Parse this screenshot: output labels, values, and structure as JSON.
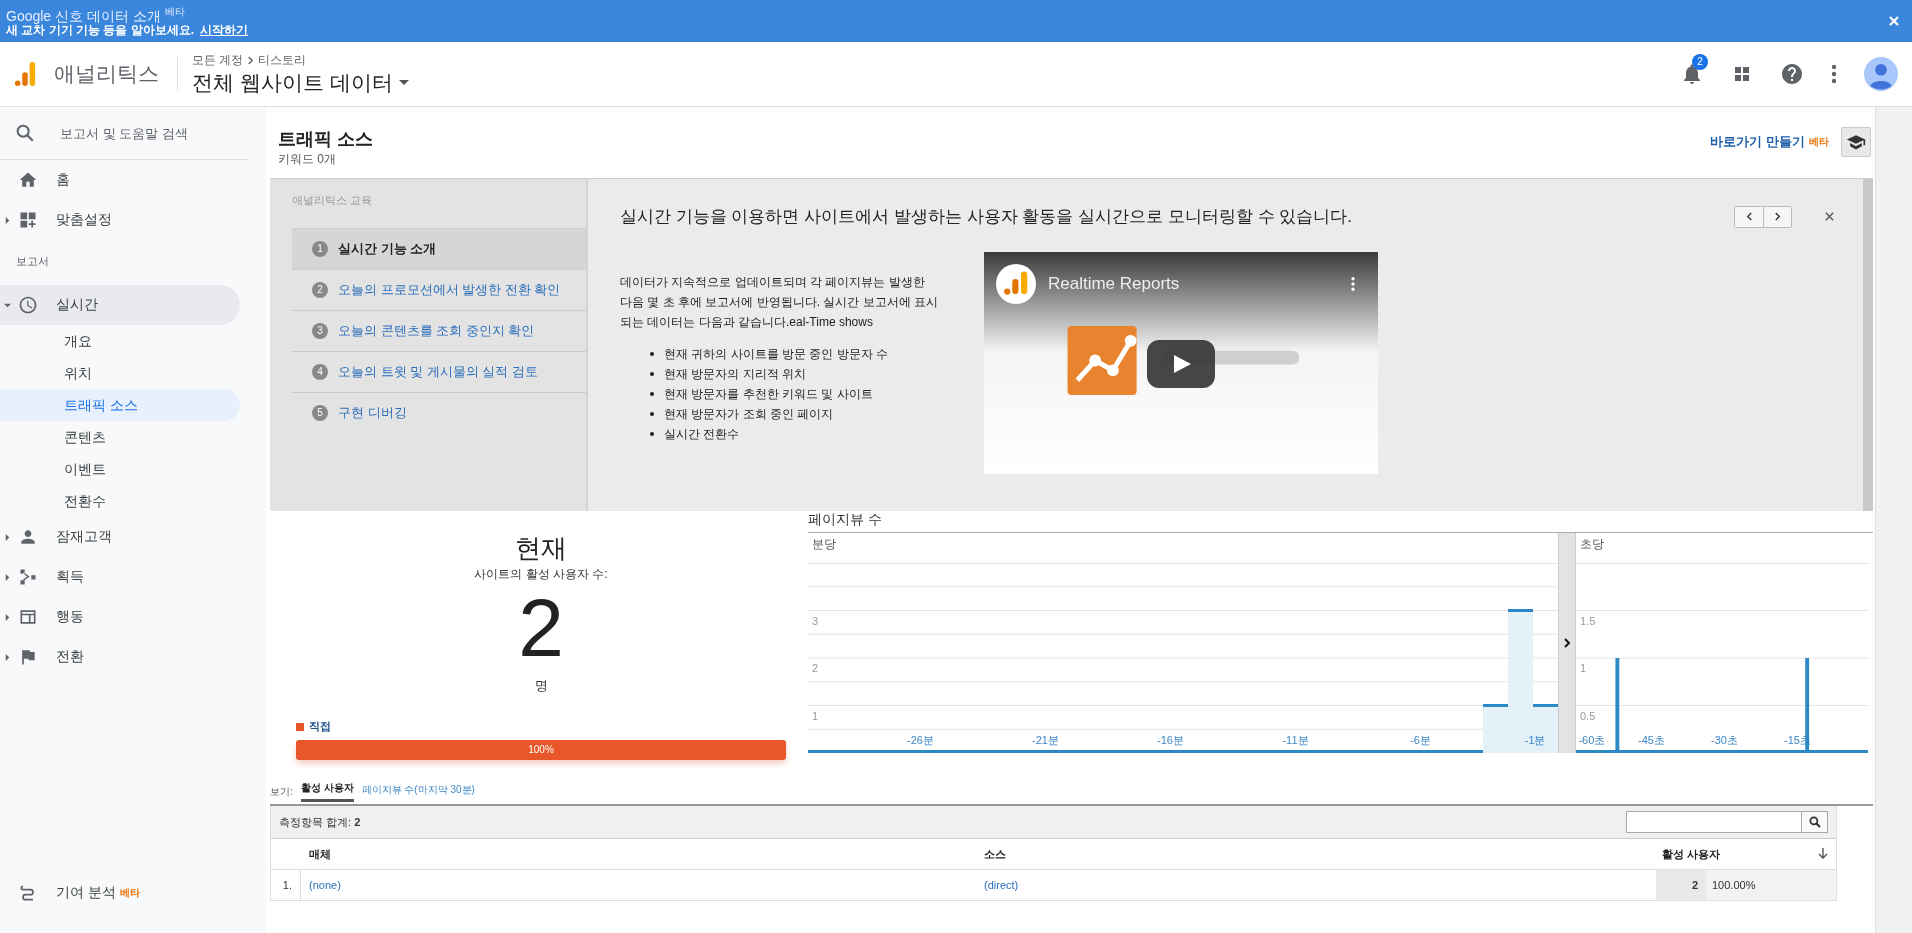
{
  "banner": {
    "title": "Google 신호 데이터 소개",
    "title_badge": "베타",
    "text": "새 교차 기기 기능 등을 알아보세요.",
    "link": "시작하기"
  },
  "header": {
    "app_name": "애널리틱스",
    "breadcrumb": [
      "모든 계정",
      "티스토리"
    ],
    "view": "전체 웹사이트 데이터",
    "notification_count": "2"
  },
  "sidebar": {
    "search": {
      "placeholder": "보고서 및 도움말 검색"
    },
    "top_items": [
      {
        "label": "홈",
        "kind": "link"
      },
      {
        "label": "맞춤설정",
        "kind": "group",
        "expanded": false
      }
    ],
    "section_label": "보고서",
    "report_items": [
      {
        "label": "실시간",
        "kind": "group",
        "expanded": true,
        "children": [
          {
            "label": "개요",
            "selected": false
          },
          {
            "label": "위치",
            "selected": false
          },
          {
            "label": "트래픽 소스",
            "selected": true
          },
          {
            "label": "콘텐츠",
            "selected": false
          },
          {
            "label": "이벤트",
            "selected": false
          },
          {
            "label": "전환수",
            "selected": false
          }
        ]
      },
      {
        "label": "잠재고객",
        "kind": "group",
        "expanded": false
      },
      {
        "label": "획득",
        "kind": "group",
        "expanded": false
      },
      {
        "label": "행동",
        "kind": "group",
        "expanded": false
      },
      {
        "label": "전환",
        "kind": "group",
        "expanded": false
      }
    ],
    "bottom_items": [
      {
        "label": "기여 분석",
        "badge": "베타"
      }
    ]
  },
  "page": {
    "title": "트래픽 소스",
    "subtitle": "키워드 0개",
    "shortcut": "바로가기 만들기",
    "shortcut_badge": "베타"
  },
  "education": {
    "heading": "애널리틱스 교육",
    "steps": [
      {
        "number": "1",
        "label": "실시간 기능 소개",
        "selected": true
      },
      {
        "number": "2",
        "label": "오늘의 프로모션에서 발생한 전환 확인",
        "selected": false
      },
      {
        "number": "3",
        "label": "오늘의 콘텐츠를 조회 중인지 확인",
        "selected": false
      },
      {
        "number": "4",
        "label": "오늘의 트윗 및 게시물의 실적 검토",
        "selected": false
      },
      {
        "number": "5",
        "label": "구현 디버깅",
        "selected": false
      }
    ],
    "title": "실시간 기능을 이용하면 사이트에서 발생하는 사용자 활동을 실시간으로 모니터링할 수 있습니다.",
    "description": "데이터가 지속적으로 업데이트되며 각 페이지뷰는 발생한 다음 몇 초 후에 보고서에 반영됩니다. 실시간 보고서에 표시되는 데이터는 다음과 같습니다.eal-Time shows",
    "bullets": [
      "현재 귀하의 사이트를 방문 중인 방문자 수",
      "현재 방문자의 지리적 위치",
      "현재 방문자를 추천한 키워드 및 사이트",
      "현재 방문자가 조회 중인 페이지",
      "실시간 전환수"
    ],
    "video": {
      "title": "Realtime Reports"
    }
  },
  "now": {
    "title": "현재",
    "label": "사이트의 활성 사용자 수:",
    "count": "2",
    "unit": "명",
    "legend": [
      {
        "label": "직접",
        "color": "#e8572a"
      }
    ],
    "bar": {
      "label": "100%",
      "level": 1
    }
  },
  "pageviews": {
    "title": "페이지뷰 수",
    "per_minute": {
      "label": "분당",
      "chart_data": {
        "type": "bar",
        "x": [
          -30,
          -29,
          -28,
          -27,
          -26,
          -25,
          -24,
          -23,
          -22,
          -21,
          -20,
          -19,
          -18,
          -17,
          -16,
          -15,
          -14,
          -13,
          -12,
          -11,
          -10,
          -9,
          -8,
          -7,
          -6,
          -5,
          -4,
          -3,
          -2,
          -1
        ],
        "values": [
          0,
          0,
          0,
          0,
          0,
          0,
          0,
          0,
          0,
          0,
          0,
          0,
          0,
          0,
          0,
          0,
          0,
          0,
          0,
          0,
          0,
          0,
          0,
          0,
          0,
          0,
          0,
          1,
          3,
          1
        ],
        "xlim": [
          -30.5,
          -0.5
        ],
        "ylim": [
          0,
          4
        ],
        "yticks": [
          1,
          2,
          3
        ],
        "grid": true,
        "xticks": [
          {
            "value": -26,
            "label": "-26분"
          },
          {
            "value": -21,
            "label": "-21분"
          },
          {
            "value": -16,
            "label": "-16분"
          },
          {
            "value": -11,
            "label": "-11분"
          },
          {
            "value": -6,
            "label": "-6분"
          },
          {
            "value": -1,
            "label": "-1분"
          }
        ]
      }
    },
    "per_second": {
      "label": "초당",
      "chart_data": {
        "type": "bar",
        "x": [
          -60,
          -59,
          -58,
          -57,
          -56,
          -55,
          -54,
          -53,
          -52,
          -51,
          -50,
          -49,
          -48,
          -47,
          -46,
          -45,
          -44,
          -43,
          -42,
          -41,
          -40,
          -39,
          -38,
          -37,
          -36,
          -35,
          -34,
          -33,
          -32,
          -31,
          -30,
          -29,
          -28,
          -27,
          -26,
          -25,
          -24,
          -23,
          -22,
          -21,
          -20,
          -19,
          -18,
          -17,
          -16,
          -15,
          -14,
          -13,
          -12,
          -11,
          -10,
          -9,
          -8,
          -7,
          -6,
          -5,
          -4,
          -3,
          -2,
          -1
        ],
        "values": [
          0,
          0,
          0,
          0,
          0,
          0,
          0,
          0,
          1,
          0,
          0,
          0,
          0,
          0,
          0,
          0,
          0,
          0,
          0,
          0,
          0,
          0,
          0,
          0,
          0,
          0,
          0,
          0,
          0,
          0,
          0,
          0,
          0,
          0,
          0,
          0,
          0,
          0,
          0,
          0,
          0,
          0,
          0,
          0,
          0,
          0,
          0,
          1,
          0,
          0,
          0,
          0,
          0,
          0,
          0,
          0,
          0,
          0,
          0,
          0
        ],
        "xlim": [
          -60.5,
          -0.5
        ],
        "ylim": [
          0,
          2
        ],
        "yticks": [
          0.5,
          1,
          1.5
        ],
        "grid": true,
        "xticks": [
          {
            "value": -60,
            "label": "-60초"
          },
          {
            "value": -45,
            "label": "-45초"
          },
          {
            "value": -30,
            "label": "-30초"
          },
          {
            "value": -15,
            "label": "-15초"
          }
        ]
      }
    }
  },
  "view_tabs": {
    "label": "보기:",
    "tabs": [
      {
        "label": "활성 사용자",
        "selected": true
      },
      {
        "label": "페이지뷰 수(마지막 30분)",
        "selected": false
      }
    ]
  },
  "table": {
    "total_label": "측정항목 합계:",
    "total_value": "2",
    "columns": [
      "매체",
      "소스",
      "활성 사용자"
    ],
    "rows": [
      {
        "index": "1.",
        "medium": "(none)",
        "source": "(direct)",
        "active_users": "2",
        "percent": "100.00%"
      }
    ]
  }
}
